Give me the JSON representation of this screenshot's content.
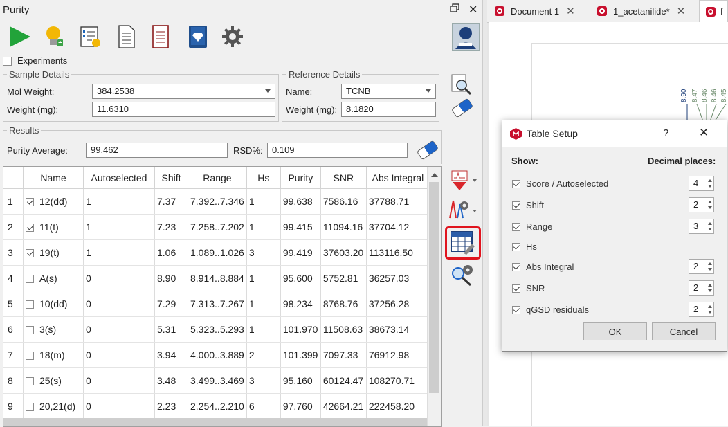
{
  "panel": {
    "title": "Purity",
    "experiments_label": "Experiments"
  },
  "sample_details": {
    "title": "Sample Details",
    "mol_weight_label": "Mol Weight:",
    "mol_weight_value": "384.2538",
    "weight_label": "Weight (mg):",
    "weight_value": "11.6310"
  },
  "reference_details": {
    "title": "Reference Details",
    "name_label": "Name:",
    "name_value": "TCNB",
    "weight_label": "Weight (mg):",
    "weight_value": "8.1820"
  },
  "results": {
    "title": "Results",
    "purity_avg_label": "Purity Average:",
    "purity_avg_value": "99.462",
    "rsd_label": "RSD%:",
    "rsd_value": "0.109"
  },
  "table": {
    "headers": [
      "Name",
      "Autoselected",
      "Shift",
      "Range",
      "Hs",
      "Purity",
      "SNR",
      "Abs Integral"
    ],
    "rows": [
      {
        "n": "1",
        "checked": true,
        "name": "12(dd)",
        "auto": "1",
        "shift": "7.37",
        "range": "7.392..7.346",
        "hs": "1",
        "purity": "99.638",
        "snr": "7586.16",
        "abs": "37788.71"
      },
      {
        "n": "2",
        "checked": true,
        "name": "11(t)",
        "auto": "1",
        "shift": "7.23",
        "range": "7.258..7.202",
        "hs": "1",
        "purity": "99.415",
        "snr": "11094.16",
        "abs": "37704.12"
      },
      {
        "n": "3",
        "checked": true,
        "name": "19(t)",
        "auto": "1",
        "shift": "1.06",
        "range": "1.089..1.026",
        "hs": "3",
        "purity": "99.419",
        "snr": "37603.20",
        "abs": "113116.50"
      },
      {
        "n": "4",
        "checked": false,
        "name": "A(s)",
        "auto": "0",
        "shift": "8.90",
        "range": "8.914..8.884",
        "hs": "1",
        "purity": "95.600",
        "snr": "5752.81",
        "abs": "36257.03"
      },
      {
        "n": "5",
        "checked": false,
        "name": "10(dd)",
        "auto": "0",
        "shift": "7.29",
        "range": "7.313..7.267",
        "hs": "1",
        "purity": "98.234",
        "snr": "8768.76",
        "abs": "37256.28"
      },
      {
        "n": "6",
        "checked": false,
        "name": "3(s)",
        "auto": "0",
        "shift": "5.31",
        "range": "5.323..5.293",
        "hs": "1",
        "purity": "101.970",
        "snr": "11508.63",
        "abs": "38673.14"
      },
      {
        "n": "7",
        "checked": false,
        "name": "18(m)",
        "auto": "0",
        "shift": "3.94",
        "range": "4.000..3.889",
        "hs": "2",
        "purity": "101.399",
        "snr": "7097.33",
        "abs": "76912.98"
      },
      {
        "n": "8",
        "checked": false,
        "name": "25(s)",
        "auto": "0",
        "shift": "3.48",
        "range": "3.499..3.469",
        "hs": "3",
        "purity": "95.160",
        "snr": "60124.47",
        "abs": "108270.71"
      },
      {
        "n": "9",
        "checked": false,
        "name": "20,21(d)",
        "auto": "0",
        "shift": "2.23",
        "range": "2.254..2.210",
        "hs": "6",
        "purity": "97.760",
        "snr": "42664.21",
        "abs": "222458.20"
      }
    ]
  },
  "tabs": [
    {
      "label": "Document 1"
    },
    {
      "label": "1_acetanilide*"
    },
    {
      "label": "f"
    }
  ],
  "spectrum_labels": [
    "8.90",
    "8.47",
    "8.46",
    "8.46",
    "8.45"
  ],
  "dialog": {
    "title": "Table Setup",
    "help": "?",
    "show_label": "Show:",
    "decimal_label": "Decimal places:",
    "options": [
      {
        "label": "Score / Autoselected",
        "checked": true,
        "decimals": "4"
      },
      {
        "label": "Shift",
        "checked": true,
        "decimals": "2"
      },
      {
        "label": "Range",
        "checked": true,
        "decimals": "3"
      },
      {
        "label": "Hs",
        "checked": true,
        "decimals": ""
      },
      {
        "label": "Abs Integral",
        "checked": true,
        "decimals": "2"
      },
      {
        "label": "SNR",
        "checked": true,
        "decimals": "2"
      },
      {
        "label": "qGSD residuals",
        "checked": true,
        "decimals": "2"
      }
    ],
    "ok": "OK",
    "cancel": "Cancel"
  },
  "colors": {
    "accent_red": "#e0141e",
    "play_green": "#22a33a",
    "dialog_logo": "#c8102e"
  },
  "icons": [
    "play-icon",
    "lightbulb-icon",
    "checklist-icon",
    "document-icon",
    "report-icon",
    "book-icon",
    "gear-icon",
    "user-avatar-icon"
  ]
}
